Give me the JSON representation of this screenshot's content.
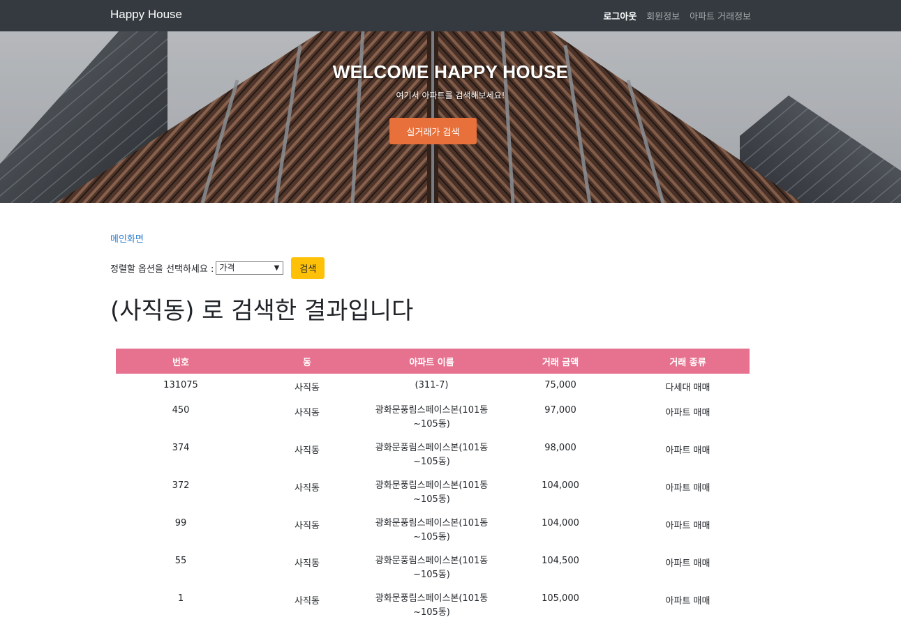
{
  "navbar": {
    "brand": "Happy House",
    "links": [
      {
        "label": "로그아웃",
        "active": true
      },
      {
        "label": "회원정보",
        "active": false
      },
      {
        "label": "아파트 거래정보",
        "active": false
      }
    ]
  },
  "hero": {
    "title": "WELCOME HAPPY HOUSE",
    "subtitle": "여기서 아파트를 검색해보세요!",
    "button_label": "실거래가 검색"
  },
  "content": {
    "home_link": "메인화면",
    "sort_label": "정렬할 옵션을 선택하세요 :",
    "sort_value": "가격",
    "search_button": "검색",
    "result_title": "(사직동) 로 검색한 결과입니다"
  },
  "table": {
    "headers": [
      "번호",
      "동",
      "아파트 이름",
      "거래 금액",
      "거래 종류"
    ],
    "rows": [
      {
        "no": "131075",
        "dong": "사직동",
        "apt": "(311-7)",
        "price": "75,000",
        "type": "다세대 매매"
      },
      {
        "no": "450",
        "dong": "사직동",
        "apt": "광화문풍림스페이스본(101동~105동)",
        "price": "97,000",
        "type": "아파트 매매"
      },
      {
        "no": "374",
        "dong": "사직동",
        "apt": "광화문풍림스페이스본(101동~105동)",
        "price": "98,000",
        "type": "아파트 매매"
      },
      {
        "no": "372",
        "dong": "사직동",
        "apt": "광화문풍림스페이스본(101동~105동)",
        "price": "104,000",
        "type": "아파트 매매"
      },
      {
        "no": "99",
        "dong": "사직동",
        "apt": "광화문풍림스페이스본(101동~105동)",
        "price": "104,000",
        "type": "아파트 매매"
      },
      {
        "no": "55",
        "dong": "사직동",
        "apt": "광화문풍림스페이스본(101동~105동)",
        "price": "104,500",
        "type": "아파트 매매"
      },
      {
        "no": "1",
        "dong": "사직동",
        "apt": "광화문풍림스페이스본(101동~105동)",
        "price": "105,000",
        "type": "아파트 매매"
      }
    ]
  },
  "colors": {
    "navbar": "#343a40",
    "hero_button": "#e8703a",
    "search_button": "#ffc107",
    "table_header": "#e7728f",
    "link": "#2a7dd1"
  }
}
